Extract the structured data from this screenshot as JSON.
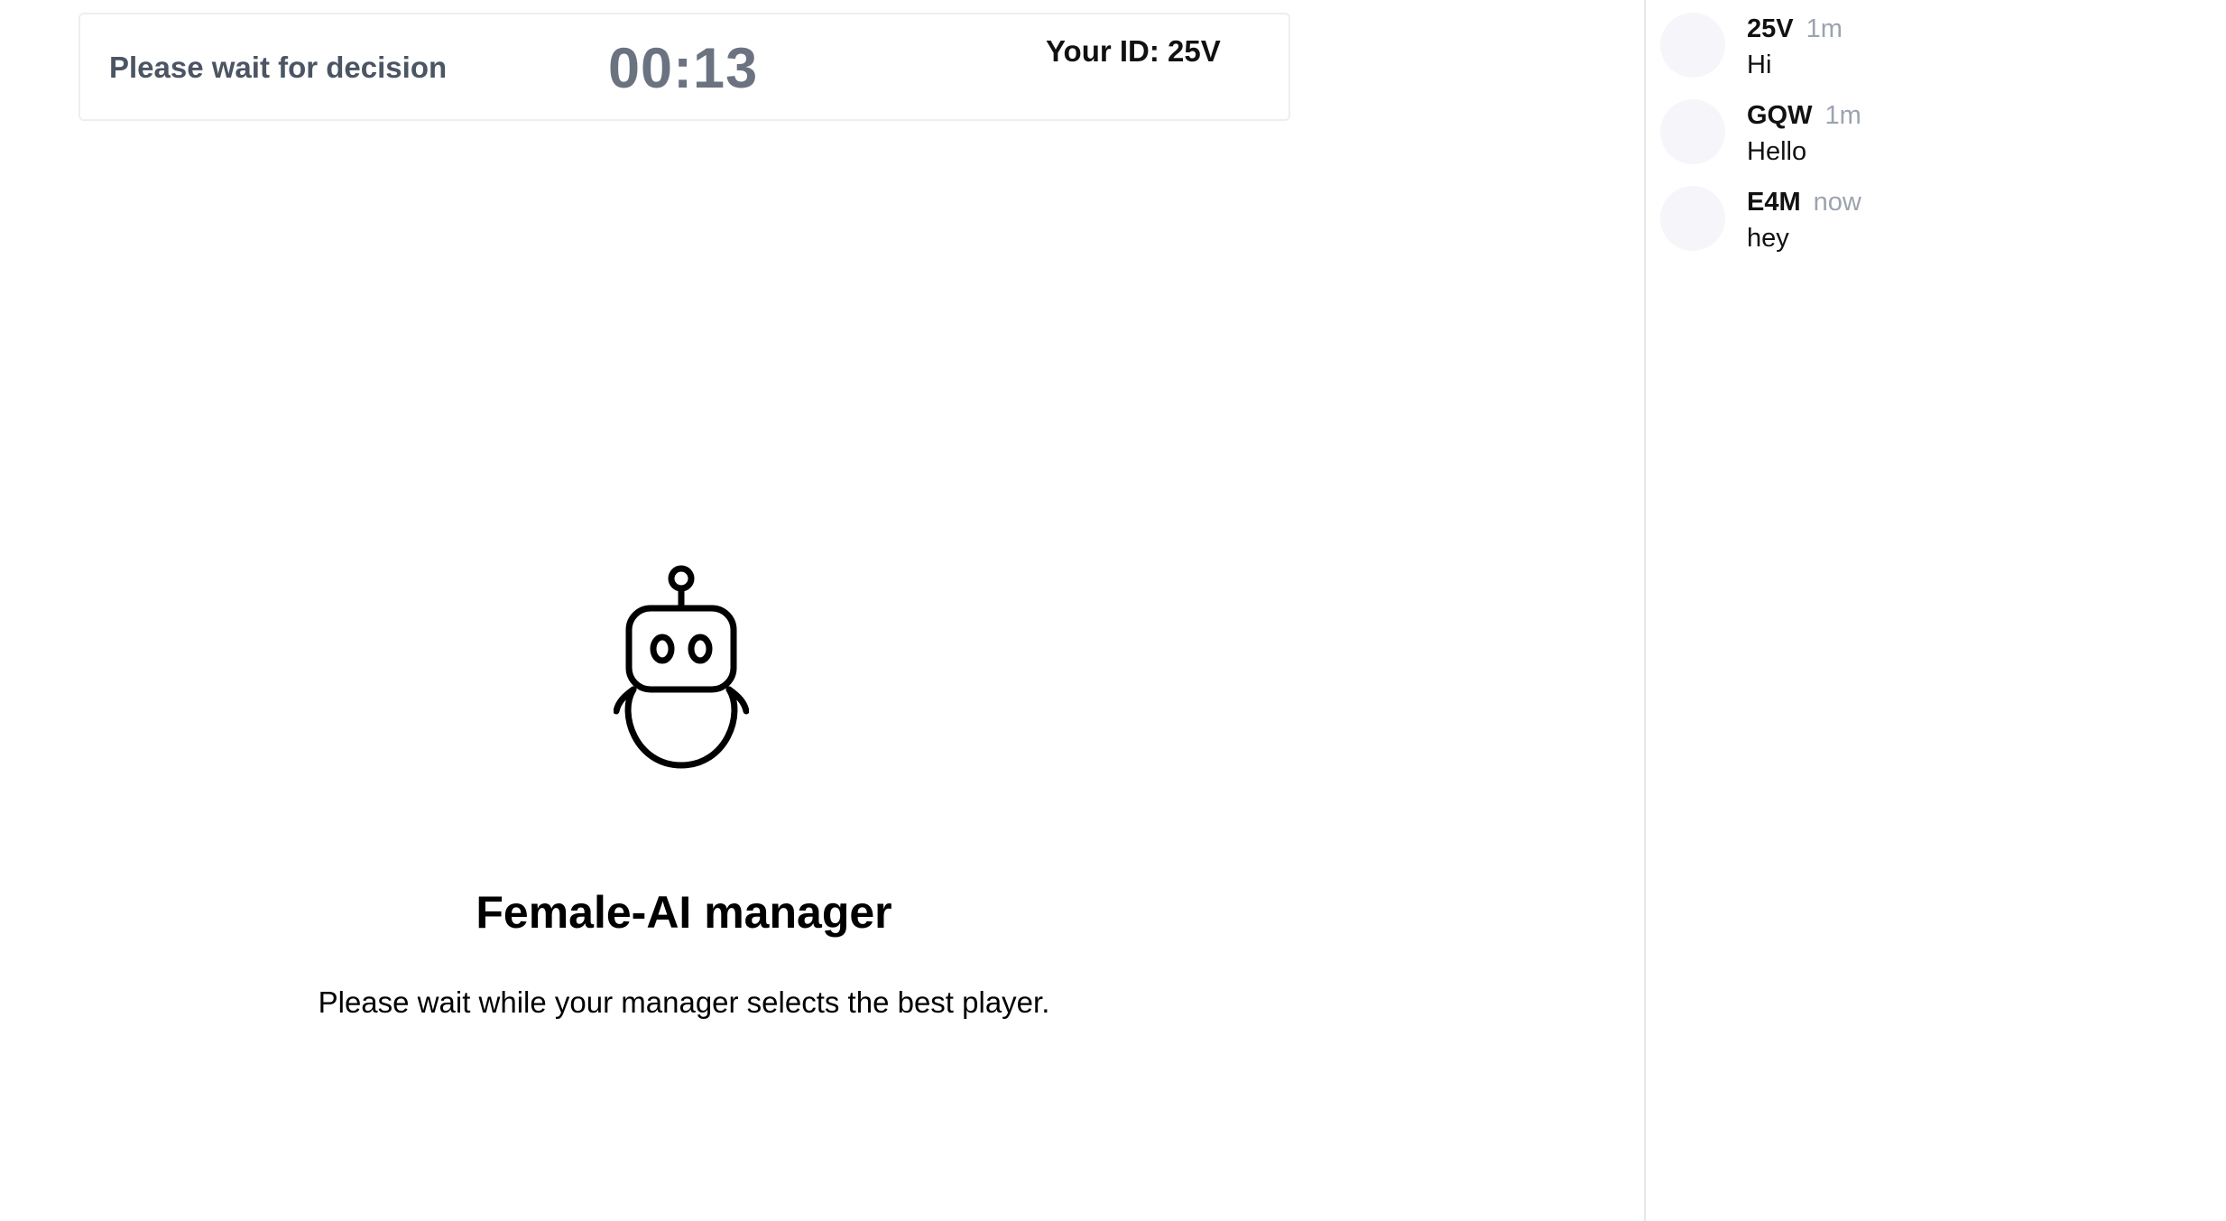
{
  "status": {
    "message": "Please wait for decision",
    "timer": "00:13",
    "your_id": "Your ID: 25V"
  },
  "manager": {
    "icon": "robot-icon",
    "title": "Female-AI manager",
    "subtitle": "Please wait while your manager selects the best player."
  },
  "chat": {
    "messages": [
      {
        "user": "25V",
        "time": "1m",
        "text": "Hi"
      },
      {
        "user": "GQW",
        "time": "1m",
        "text": "Hello"
      },
      {
        "user": "E4M",
        "time": "now",
        "text": "hey"
      }
    ]
  },
  "colors": {
    "status_text": "#4b5563",
    "timer": "#6b7280",
    "time_muted": "#9ca3af",
    "avatar_bg": "#f6f5fa",
    "border": "#e5e7eb"
  }
}
